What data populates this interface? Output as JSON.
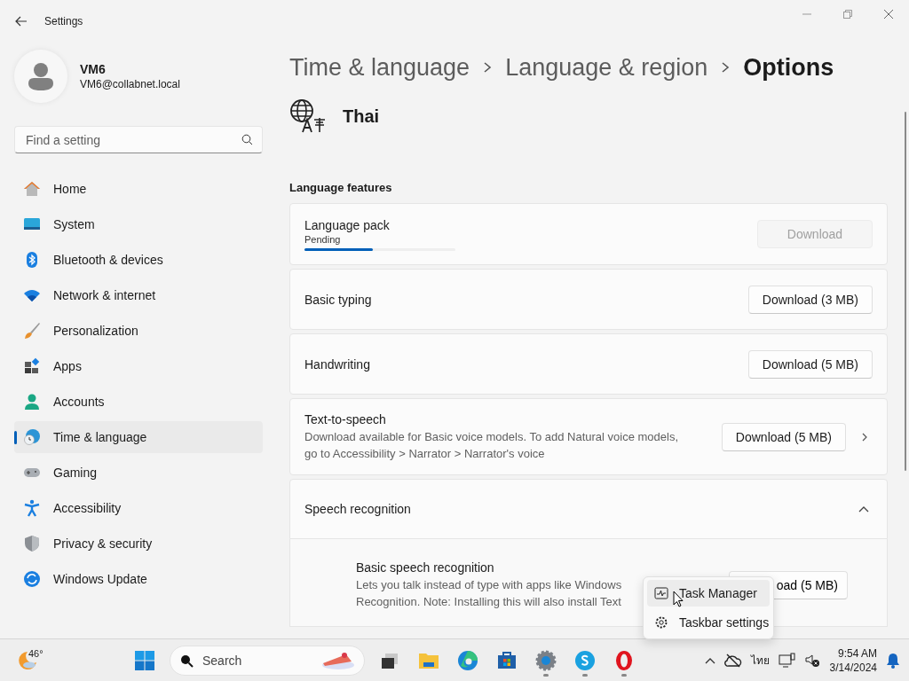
{
  "window": {
    "title": "Settings"
  },
  "user": {
    "name": "VM6",
    "email": "VM6@collabnet.local"
  },
  "search": {
    "placeholder": "Find a setting"
  },
  "nav": [
    {
      "label": "Home",
      "selected": false
    },
    {
      "label": "System",
      "selected": false
    },
    {
      "label": "Bluetooth & devices",
      "selected": false
    },
    {
      "label": "Network & internet",
      "selected": false
    },
    {
      "label": "Personalization",
      "selected": false
    },
    {
      "label": "Apps",
      "selected": false
    },
    {
      "label": "Accounts",
      "selected": false
    },
    {
      "label": "Time & language",
      "selected": true
    },
    {
      "label": "Gaming",
      "selected": false
    },
    {
      "label": "Accessibility",
      "selected": false
    },
    {
      "label": "Privacy & security",
      "selected": false
    },
    {
      "label": "Windows Update",
      "selected": false
    }
  ],
  "breadcrumb": [
    "Time & language",
    "Language & region",
    "Options"
  ],
  "language": "Thai",
  "section_title": "Language features",
  "features": [
    {
      "kind": "progress",
      "title": "Language pack",
      "status": "Pending",
      "level": 0.45,
      "button": "Download",
      "disabled": true
    },
    {
      "kind": "button",
      "title": "Basic typing",
      "button": "Download (3 MB)",
      "disabled": false
    },
    {
      "kind": "button",
      "title": "Handwriting",
      "button": "Download (5 MB)",
      "disabled": false
    },
    {
      "kind": "link",
      "title": "Text-to-speech",
      "description": "Download available for Basic voice models. To add Natural voice models,\ngo to Accessibility > Narrator > Narrator's voice",
      "button": "Download (5 MB)",
      "disabled": false
    },
    {
      "kind": "expander",
      "title": "Speech recognition",
      "expanded": true,
      "children": [
        {
          "title": "Basic speech recognition",
          "description": "Lets you talk instead of type with apps like Windows\nRecognition. Note: Installing this will also install Text",
          "button": "oad (5 MB)"
        }
      ]
    }
  ],
  "context_menu": [
    {
      "label": "Task Manager",
      "selected": true
    },
    {
      "label": "Taskbar settings",
      "selected": false
    }
  ],
  "taskbar": {
    "weather": "46°",
    "search": "Search",
    "apps": [
      {
        "running": false
      },
      {
        "running": false
      },
      {
        "running": false
      },
      {
        "running": false
      },
      {
        "running": true
      },
      {
        "running": true
      },
      {
        "running": true
      }
    ],
    "input_language": "ไทย",
    "time": "9:54 AM",
    "date": "3/14/2024"
  }
}
